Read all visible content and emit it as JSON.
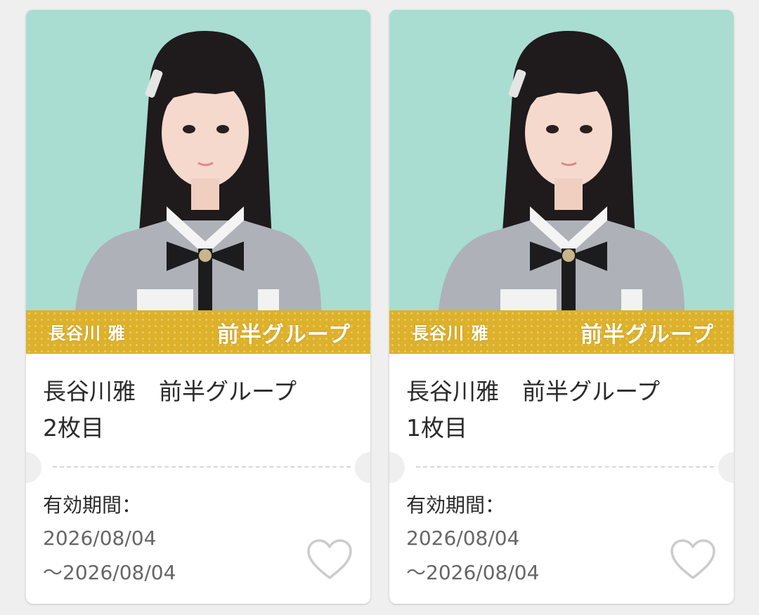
{
  "cards": [
    {
      "banner_name": "長谷川 雅",
      "banner_group": "前半グループ",
      "title_line1": "長谷川雅　前半グループ",
      "title_line2": "2枚目",
      "validity_label": "有効期間：",
      "validity_start": "2026/08/04",
      "validity_end": "～2026/08/04",
      "favorite_icon": "heart-outline-icon"
    },
    {
      "banner_name": "長谷川 雅",
      "banner_group": "前半グループ",
      "title_line1": "長谷川雅　前半グループ",
      "title_line2": "1枚目",
      "validity_label": "有効期間：",
      "validity_start": "2026/08/04",
      "validity_end": "～2026/08/04",
      "favorite_icon": "heart-outline-icon"
    }
  ],
  "colors": {
    "background": "#efefef",
    "photo_background": "#a9ddd2",
    "banner": "#ddb12a",
    "title_text": "#2a2a2a",
    "date_text": "#666666",
    "heart_stroke": "#cccccc"
  }
}
